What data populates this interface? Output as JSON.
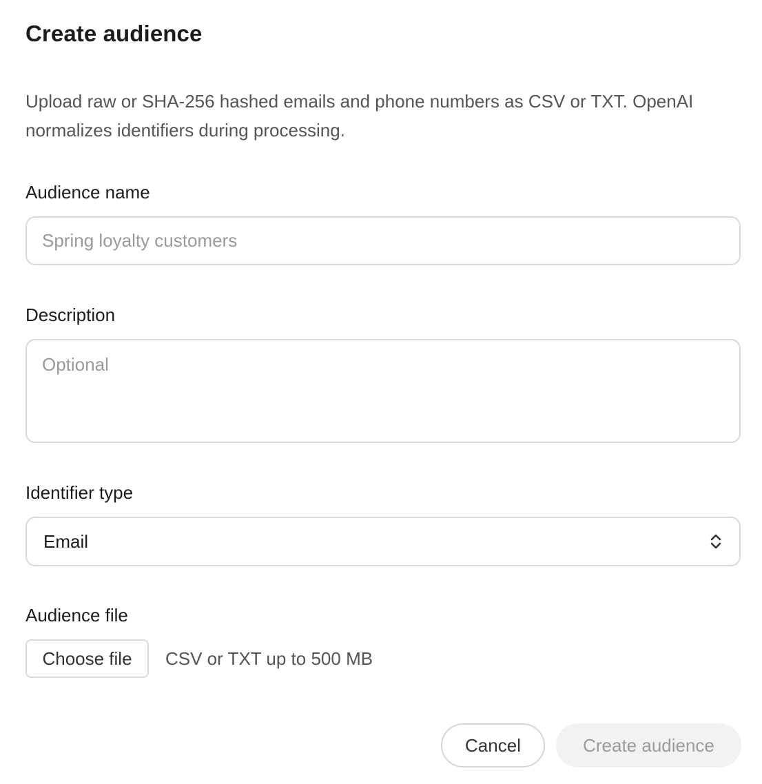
{
  "dialog": {
    "title": "Create audience",
    "description": "Upload raw or SHA-256 hashed emails and phone numbers as CSV or TXT. OpenAI normalizes identifiers during processing."
  },
  "form": {
    "name_label": "Audience name",
    "name_placeholder": "Spring loyalty customers",
    "description_label": "Description",
    "description_placeholder": "Optional",
    "identifier_label": "Identifier type",
    "identifier_value": "Email",
    "file_label": "Audience file",
    "file_button_label": "Choose file",
    "file_hint": "CSV or TXT up to 500 MB"
  },
  "actions": {
    "cancel_label": "Cancel",
    "create_label": "Create audience",
    "create_disabled": true
  },
  "icons": {
    "identifier_select": "chevron-up-down-icon"
  },
  "colors": {
    "text_primary": "#1c1c1c",
    "text_secondary": "#555555",
    "placeholder": "#9a9a9a",
    "border": "#d9d9d9",
    "disabled_bg": "#f2f2f2",
    "disabled_text": "#9b9b9b"
  }
}
